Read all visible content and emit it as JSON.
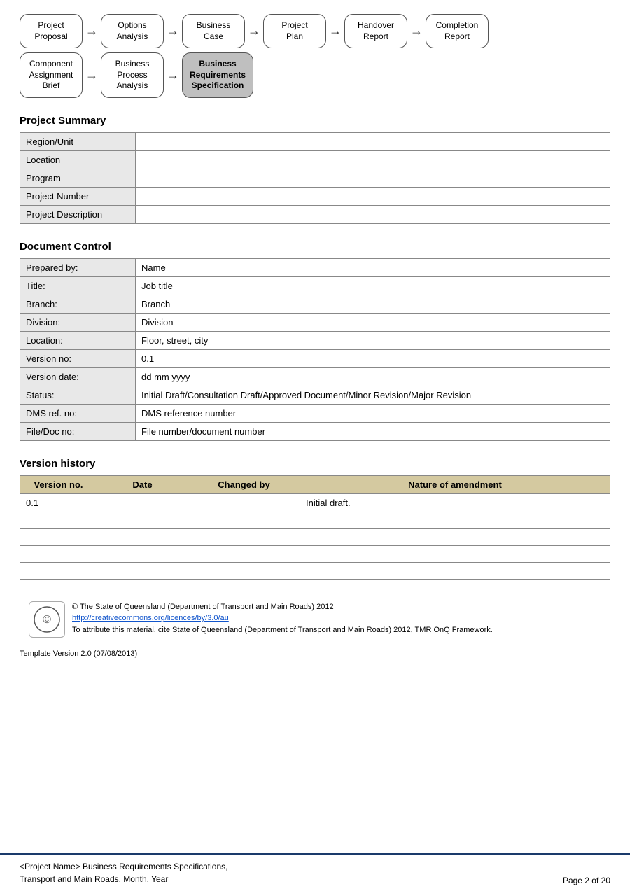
{
  "flowRow1": {
    "boxes": [
      {
        "label": "Project\nProposal",
        "active": false
      },
      {
        "label": "Options\nAnalysis",
        "active": false
      },
      {
        "label": "Business\nCase",
        "active": false
      },
      {
        "label": "Project\nPlan",
        "active": false
      },
      {
        "label": "Handover\nReport",
        "active": false
      },
      {
        "label": "Completion\nReport",
        "active": false
      }
    ]
  },
  "flowRow2": {
    "boxes": [
      {
        "label": "Component\nAssignment\nBrief",
        "active": false
      },
      {
        "label": "Business\nProcess\nAnalysis",
        "active": false
      },
      {
        "label": "Business\nRequirements\nSpecification",
        "active": true
      }
    ]
  },
  "projectSummary": {
    "title": "Project Summary",
    "rows": [
      {
        "label": "Region/Unit",
        "value": ""
      },
      {
        "label": "Location",
        "value": ""
      },
      {
        "label": "Program",
        "value": ""
      },
      {
        "label": "Project Number",
        "value": ""
      },
      {
        "label": "Project Description",
        "value": ""
      }
    ]
  },
  "documentControl": {
    "title": "Document Control",
    "rows": [
      {
        "label": "Prepared by:",
        "value": "Name"
      },
      {
        "label": "Title:",
        "value": "Job title"
      },
      {
        "label": "Branch:",
        "value": "Branch"
      },
      {
        "label": "Division:",
        "value": "Division"
      },
      {
        "label": "Location:",
        "value": "Floor, street, city"
      },
      {
        "label": "Version no:",
        "value": "0.1"
      },
      {
        "label": "Version date:",
        "value": "dd mm yyyy"
      },
      {
        "label": "Status:",
        "value": "Initial Draft/Consultation Draft/Approved Document/Minor Revision/Major Revision"
      },
      {
        "label": "DMS ref. no:",
        "value": "DMS reference number"
      },
      {
        "label": "File/Doc no:",
        "value": "File number/document number"
      }
    ]
  },
  "versionHistory": {
    "title": "Version history",
    "headers": [
      "Version no.",
      "Date",
      "Changed by",
      "Nature of amendment"
    ],
    "rows": [
      {
        "version": "0.1",
        "date": "",
        "changedBy": "",
        "nature": "Initial draft."
      },
      {
        "version": "",
        "date": "",
        "changedBy": "",
        "nature": ""
      },
      {
        "version": "",
        "date": "",
        "changedBy": "",
        "nature": ""
      },
      {
        "version": "",
        "date": "",
        "changedBy": "",
        "nature": ""
      },
      {
        "version": "",
        "date": "",
        "changedBy": "",
        "nature": ""
      }
    ]
  },
  "footer": {
    "copyright": "© The State of Queensland (Department of Transport and Main Roads) 2012",
    "link": "http://creativecommons.org/licences/by/3.0/au",
    "attribution": "To attribute this material, cite State of Queensland (Department of Transport and Main Roads) 2012, TMR OnQ Framework.",
    "templateVersion": "Template Version 2.0 (07/08/2013)"
  },
  "pageFooter": {
    "line1": "<Project Name> Business Requirements Specifications,",
    "line2": "Transport and Main Roads, Month, Year",
    "pageInfo": "Page 2 of 20"
  }
}
